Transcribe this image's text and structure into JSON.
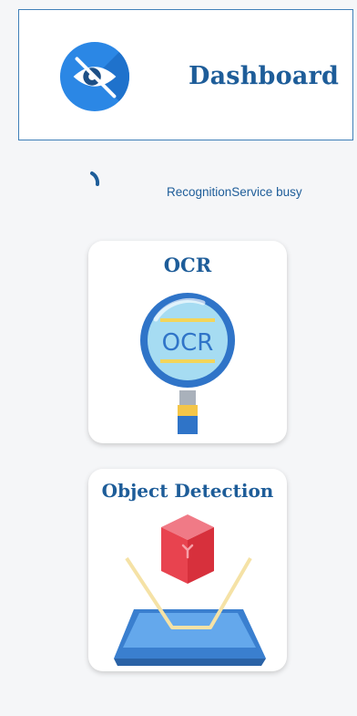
{
  "header": {
    "title": "Dashboard",
    "logo_icon": "eye-slash-icon"
  },
  "status": {
    "text": "RecognitionService busy",
    "indicator": "loading-spinner"
  },
  "cards": [
    {
      "title": "OCR",
      "icon": "ocr-magnifier-icon",
      "icon_text": "OCR"
    },
    {
      "title": "Object Detection",
      "icon": "object-detection-icon"
    }
  ],
  "colors": {
    "accent": "#1e5d99",
    "logo_blue": "#2b87e5",
    "background": "#f5f6f8",
    "card": "#ffffff"
  }
}
